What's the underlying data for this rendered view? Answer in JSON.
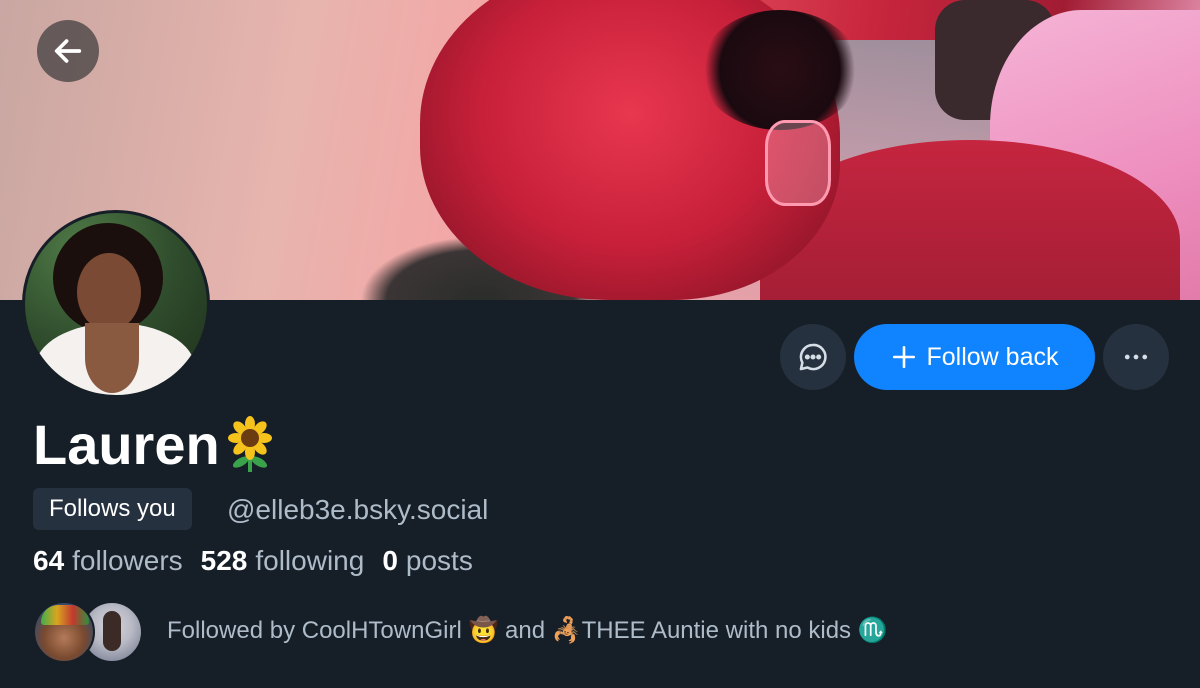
{
  "banner": {
    "alt": "banner image"
  },
  "nav": {
    "back_icon": "arrow-left-icon"
  },
  "profile": {
    "display_name": "Lauren",
    "name_emoji": "🌻",
    "follows_you_badge": "Follows you",
    "handle": "@elleb3e.bsky.social",
    "stats": {
      "followers_count": "64",
      "followers_label": "followers",
      "following_count": "528",
      "following_label": "following",
      "posts_count": "0",
      "posts_label": "posts"
    },
    "followed_by_text": "Followed by CoolHTownGirl 🤠 and 🦂THEE Auntie with no kids ♏"
  },
  "actions": {
    "message_icon": "chat-bubble-icon",
    "follow_back_label": "Follow back",
    "follow_icon": "plus-icon",
    "more_icon": "more-horizontal-icon"
  },
  "colors": {
    "background": "#161e27",
    "button_surface": "#26313f",
    "accent_blue": "#1083fe",
    "secondary_text": "#aebbc9"
  }
}
